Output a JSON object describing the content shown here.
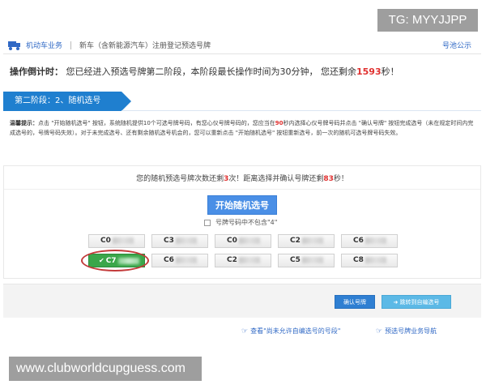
{
  "watermarks": {
    "top_right": "TG: MYYJJPP",
    "bottom_left": "www.clubworldcupguess.com"
  },
  "header": {
    "module": "机动车业务",
    "breadcrumb": "新车（含新能源汽车）注册登记预选号牌",
    "notice_link": "号池公示"
  },
  "countdown": {
    "label": "操作倒计时：",
    "text_before": "您已经进入预选号牌第二阶段，本阶段最长操作时间为30分钟， 您还剩余",
    "seconds": "1593",
    "text_after": "秒！"
  },
  "stage": {
    "title": "第二阶段：2、随机选号"
  },
  "tips": {
    "label": "温馨提示：",
    "part1": "点击 \"开始随机选号\" 按钮，系统随机提供10个可选号牌号码，有您心仪号牌号码的，您应当在",
    "seconds": "90",
    "part2": "秒内选择心仪号牌号码并点击 \"确认号牌\" 按钮完成选号（未在规定时间内完成选号的，号牌号码失效）。对于未完成选号、还有剩余随机选号机会的，您可以重新点击 \"开始随机选号\" 按钮重新选号，前一次的随机可选号牌号码失效。"
  },
  "panel": {
    "status_before": "您的随机预选号牌次数还剩",
    "remaining_times": "3",
    "status_middle": "次！距离选择并确认号牌还剩",
    "remaining_seconds": "83",
    "status_after": "秒！",
    "start_button": "开始随机选号",
    "exclude_label": "号牌号码中不包含\"4\"",
    "plates": [
      {
        "prefix": "C0",
        "selected": false
      },
      {
        "prefix": "C3",
        "selected": false
      },
      {
        "prefix": "C0",
        "selected": false
      },
      {
        "prefix": "C2",
        "selected": false
      },
      {
        "prefix": "C6",
        "selected": false
      },
      {
        "prefix": "C7",
        "selected": true
      },
      {
        "prefix": "C6",
        "selected": false
      },
      {
        "prefix": "C2",
        "selected": false
      },
      {
        "prefix": "C5",
        "selected": false
      },
      {
        "prefix": "C8",
        "selected": false
      }
    ]
  },
  "actions": {
    "confirm": "确认号牌",
    "jump": "跳转到自编选号"
  },
  "links": {
    "view_disallowed": "查看\"尚未允许自编选号的号段\"",
    "guide": "预选号牌业务导航"
  },
  "colors": {
    "brand_blue": "#1f7fcf",
    "highlight_red": "#e0302f",
    "selected_green": "#3aa64a"
  }
}
